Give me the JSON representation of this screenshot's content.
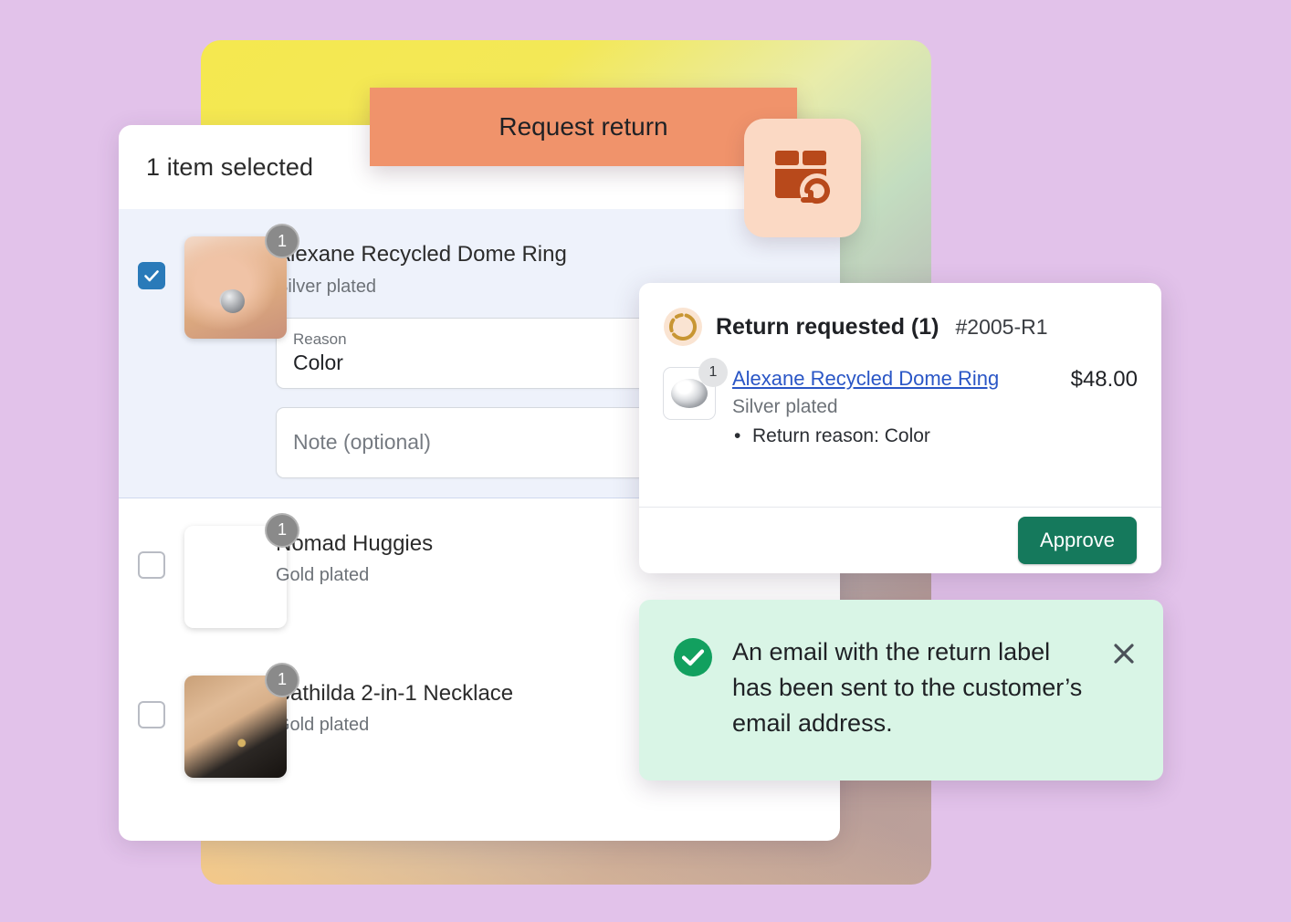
{
  "page": {
    "background_color": "#e2c2ea"
  },
  "items_card": {
    "header_title": "1 item selected",
    "rows": [
      {
        "title": "Alexane Recycled Dome Ring",
        "variant": "Silver plated",
        "quantity": "1",
        "selected": true,
        "checkbox_state": "checked",
        "thumbnail": "hand-with-dome-ring-photo"
      },
      {
        "title": "Nomad Huggies",
        "variant": "Gold plated",
        "quantity": "1",
        "selected": false,
        "checkbox_state": "unchecked",
        "thumbnail": "ear-with-huggie-earrings-photo"
      },
      {
        "title": "Bathilda 2-in-1 Necklace",
        "variant": "Gold plated",
        "quantity": "1",
        "selected": false,
        "checkbox_state": "unchecked",
        "thumbnail": "neck-with-layered-necklace-photo"
      }
    ],
    "fields": {
      "reason": {
        "label": "Reason",
        "value": "Color"
      },
      "note": {
        "placeholder": "Note (optional)"
      }
    }
  },
  "request_return": {
    "button_label": "Request return",
    "button_color": "#f0936b",
    "icon_name": "box-return-icon",
    "icon_tile_color": "#fbd9c4",
    "icon_color": "#b8491b"
  },
  "return_panel": {
    "status_icon_name": "return-requested-status-icon",
    "status_icon_color": "#c89633",
    "title": "Return requested (1)",
    "order_number": "#2005-R1",
    "line_item": {
      "quantity": "1",
      "product_link": "Alexane Recycled Dome Ring",
      "variant": "Silver plated",
      "return_reason": "Return reason: Color",
      "price": "$48.00",
      "thumbnail": "silver-dome-ring-product-image"
    },
    "approve_label": "Approve",
    "approve_color": "#15795c",
    "link_color": "#2a56c6"
  },
  "toast": {
    "icon_name": "success-check-icon",
    "icon_color": "#12a05f",
    "background_color": "#d9f5e6",
    "message": "An email with the return label has been sent to the customer’s email address.",
    "close_icon_name": "close-icon"
  }
}
